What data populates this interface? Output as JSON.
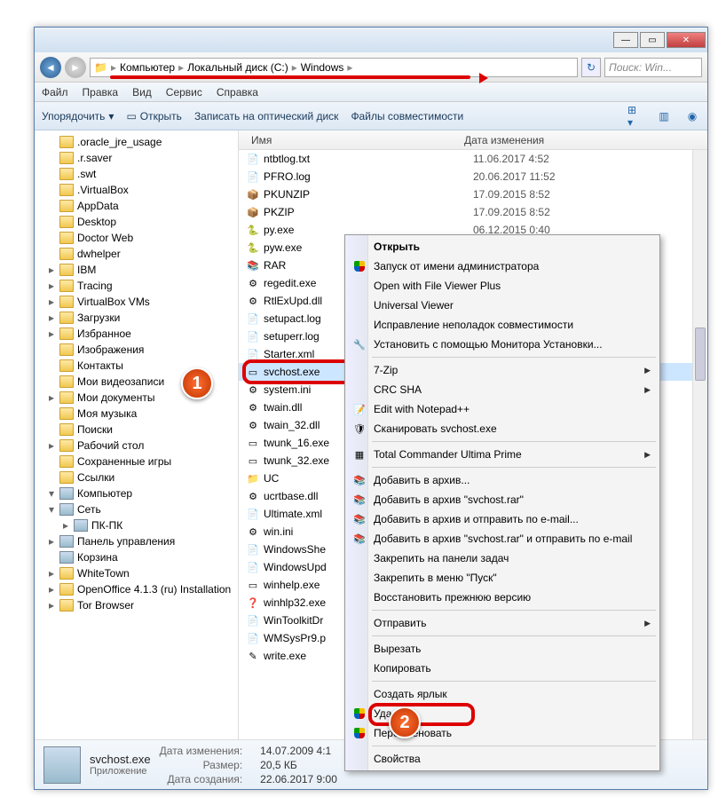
{
  "titlebar": {
    "min": "—",
    "max": "▭",
    "close": "✕"
  },
  "nav": {
    "crumbs": [
      "Компьютер",
      "Локальный диск (C:)",
      "Windows"
    ],
    "search_placeholder": "Поиск: Win..."
  },
  "menubar": [
    "Файл",
    "Правка",
    "Вид",
    "Сервис",
    "Справка"
  ],
  "toolbar": {
    "organize": "Упорядочить",
    "open": "Открыть",
    "burn": "Записать на оптический диск",
    "compat": "Файлы совместимости"
  },
  "tree": [
    {
      "l": 1,
      "t": "f",
      "label": ".oracle_jre_usage"
    },
    {
      "l": 1,
      "t": "f",
      "label": ".r.saver"
    },
    {
      "l": 1,
      "t": "f",
      "label": ".swt"
    },
    {
      "l": 1,
      "t": "f",
      "label": ".VirtualBox"
    },
    {
      "l": 1,
      "t": "f",
      "label": "AppData"
    },
    {
      "l": 1,
      "t": "f",
      "label": "Desktop"
    },
    {
      "l": 1,
      "t": "f",
      "label": "Doctor Web"
    },
    {
      "l": 1,
      "t": "f",
      "label": "dwhelper"
    },
    {
      "l": 1,
      "t": "f",
      "label": "IBM",
      "tri": "▸"
    },
    {
      "l": 1,
      "t": "f",
      "label": "Tracing",
      "tri": "▸"
    },
    {
      "l": 1,
      "t": "f",
      "label": "VirtualBox VMs",
      "tri": "▸"
    },
    {
      "l": 1,
      "t": "f",
      "label": "Загрузки",
      "tri": "▸"
    },
    {
      "l": 1,
      "t": "f",
      "label": "Избранное",
      "tri": "▸"
    },
    {
      "l": 1,
      "t": "f",
      "label": "Изображения"
    },
    {
      "l": 1,
      "t": "f",
      "label": "Контакты"
    },
    {
      "l": 1,
      "t": "f",
      "label": "Мои видеозаписи"
    },
    {
      "l": 1,
      "t": "f",
      "label": "Мои документы",
      "tri": "▸"
    },
    {
      "l": 1,
      "t": "f",
      "label": "Моя музыка"
    },
    {
      "l": 1,
      "t": "f",
      "label": "Поиски"
    },
    {
      "l": 1,
      "t": "f",
      "label": "Рабочий стол",
      "tri": "▸"
    },
    {
      "l": 1,
      "t": "f",
      "label": "Сохраненные игры"
    },
    {
      "l": 1,
      "t": "f",
      "label": "Ссылки"
    },
    {
      "l": 0,
      "t": "c",
      "label": "Компьютер",
      "tri": "▾"
    },
    {
      "l": 1,
      "t": "c",
      "label": "Сеть",
      "tri": "▾"
    },
    {
      "l": 2,
      "t": "c",
      "label": "ПК-ПК",
      "tri": "▸"
    },
    {
      "l": 1,
      "t": "c",
      "label": "Панель управления",
      "tri": "▸"
    },
    {
      "l": 1,
      "t": "c",
      "label": "Корзина"
    },
    {
      "l": 1,
      "t": "f",
      "label": "WhiteTown",
      "tri": "▸"
    },
    {
      "l": 1,
      "t": "f",
      "label": "OpenOffice 4.1.3 (ru) Installation",
      "tri": "▸"
    },
    {
      "l": 1,
      "t": "f",
      "label": "Tor Browser",
      "tri": "▸"
    }
  ],
  "cols": {
    "name": "Имя",
    "date": "Дата изменения"
  },
  "files": [
    {
      "icon": "📄",
      "name": "ntbtlog.txt",
      "date": "11.06.2017 4:52"
    },
    {
      "icon": "📄",
      "name": "PFRO.log",
      "date": "20.06.2017 11:52"
    },
    {
      "icon": "📦",
      "name": "PKUNZIP",
      "date": "17.09.2015 8:52"
    },
    {
      "icon": "📦",
      "name": "PKZIP",
      "date": "17.09.2015 8:52"
    },
    {
      "icon": "🐍",
      "name": "py.exe",
      "date": "06.12.2015 0:40"
    },
    {
      "icon": "🐍",
      "name": "pyw.exe",
      "date": ""
    },
    {
      "icon": "📚",
      "name": "RAR",
      "date": ""
    },
    {
      "icon": "⚙",
      "name": "regedit.exe",
      "date": ""
    },
    {
      "icon": "⚙",
      "name": "RtlExUpd.dll",
      "date": ""
    },
    {
      "icon": "📄",
      "name": "setupact.log",
      "date": ""
    },
    {
      "icon": "📄",
      "name": "setuperr.log",
      "date": ""
    },
    {
      "icon": "📄",
      "name": "Starter.xml",
      "date": ""
    },
    {
      "icon": "▭",
      "name": "svchost.exe",
      "date": "",
      "sel": true
    },
    {
      "icon": "⚙",
      "name": "system.ini",
      "date": ""
    },
    {
      "icon": "⚙",
      "name": "twain.dll",
      "date": ""
    },
    {
      "icon": "⚙",
      "name": "twain_32.dll",
      "date": ""
    },
    {
      "icon": "▭",
      "name": "twunk_16.exe",
      "date": ""
    },
    {
      "icon": "▭",
      "name": "twunk_32.exe",
      "date": ""
    },
    {
      "icon": "📁",
      "name": "UC",
      "date": ""
    },
    {
      "icon": "⚙",
      "name": "ucrtbase.dll",
      "date": ""
    },
    {
      "icon": "📄",
      "name": "Ultimate.xml",
      "date": ""
    },
    {
      "icon": "⚙",
      "name": "win.ini",
      "date": ""
    },
    {
      "icon": "📄",
      "name": "WindowsShe",
      "date": ""
    },
    {
      "icon": "📄",
      "name": "WindowsUpd",
      "date": ""
    },
    {
      "icon": "▭",
      "name": "winhelp.exe",
      "date": ""
    },
    {
      "icon": "❓",
      "name": "winhlp32.exe",
      "date": ""
    },
    {
      "icon": "📄",
      "name": "WinToolkitDr",
      "date": ""
    },
    {
      "icon": "📄",
      "name": "WMSysPr9.p",
      "date": ""
    },
    {
      "icon": "✎",
      "name": "write.exe",
      "date": ""
    }
  ],
  "ctx": [
    {
      "label": "Открыть",
      "bold": true
    },
    {
      "label": "Запуск от имени администратора",
      "icon": "shield"
    },
    {
      "label": "Open with File Viewer Plus"
    },
    {
      "label": "Universal Viewer"
    },
    {
      "label": "Исправление неполадок совместимости"
    },
    {
      "label": "Установить с помощью Монитора Установки...",
      "icon": "🔧"
    },
    {
      "sep": true
    },
    {
      "label": "7-Zip",
      "arrow": true
    },
    {
      "label": "CRC SHA",
      "arrow": true
    },
    {
      "label": "Edit with Notepad++",
      "icon": "📝"
    },
    {
      "label": "Сканировать svchost.exe",
      "icon": "🛡"
    },
    {
      "sep": true
    },
    {
      "label": "Total Commander Ultima Prime",
      "icon": "▦",
      "arrow": true
    },
    {
      "sep": true
    },
    {
      "label": "Добавить в архив...",
      "icon": "📚"
    },
    {
      "label": "Добавить в архив \"svchost.rar\"",
      "icon": "📚"
    },
    {
      "label": "Добавить в архив и отправить по e-mail...",
      "icon": "📚"
    },
    {
      "label": "Добавить в архив \"svchost.rar\" и отправить по e-mail",
      "icon": "📚"
    },
    {
      "label": "Закрепить на панели задач"
    },
    {
      "label": "Закрепить в меню \"Пуск\""
    },
    {
      "label": "Восстановить прежнюю версию"
    },
    {
      "sep": true
    },
    {
      "label": "Отправить",
      "arrow": true
    },
    {
      "sep": true
    },
    {
      "label": "Вырезать"
    },
    {
      "label": "Копировать"
    },
    {
      "sep": true
    },
    {
      "label": "Создать ярлык"
    },
    {
      "label": "Удалить",
      "icon": "shield"
    },
    {
      "label": "Переименовать",
      "icon": "shield"
    },
    {
      "sep": true
    },
    {
      "label": "Свойства"
    }
  ],
  "status": {
    "fname": "svchost.exe",
    "ftype": "Приложение",
    "mod_lbl": "Дата изменения:",
    "mod_val": "14.07.2009 4:1",
    "size_lbl": "Размер:",
    "size_val": "20,5 КБ",
    "created_lbl": "Дата создания:",
    "created_val": "22.06.2017 9:00"
  },
  "badges": {
    "one": "1",
    "two": "2"
  }
}
